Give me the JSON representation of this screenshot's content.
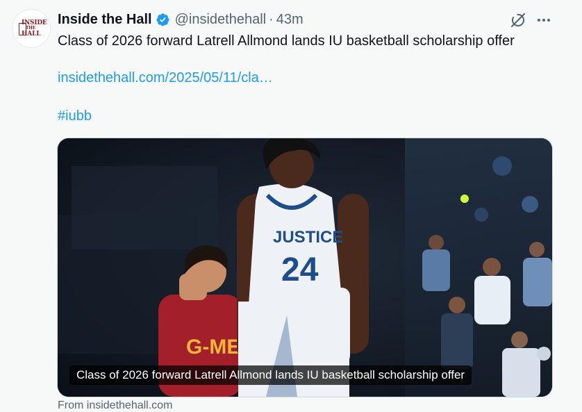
{
  "author": {
    "name": "Inside the Hall",
    "handle": "@insidethehall",
    "separator": "·",
    "time": "43m",
    "avatar_text": [
      "INSIDE",
      "THE",
      "HALL"
    ]
  },
  "tweet": {
    "text": "Class of 2026 forward Latrell Allmond lands IU basketball scholarship offer",
    "link": "insidethehall.com/2025/05/11/cla…",
    "hashtag": "#iubb"
  },
  "card": {
    "caption": "Class of 2026 forward Latrell Allmond lands IU basketball scholarship offer",
    "jersey_text": "JUSTICE",
    "jersey_number": "24",
    "opponent_jersey_text": "G-MEN",
    "source": "From insidethehall.com"
  },
  "icons": {
    "verified": "verified-badge-icon",
    "grok": "grok-icon",
    "more": "more-icon"
  },
  "colors": {
    "link": "#1d9bf0",
    "verified": "#1d9bf0",
    "secondary_text": "#536471"
  }
}
